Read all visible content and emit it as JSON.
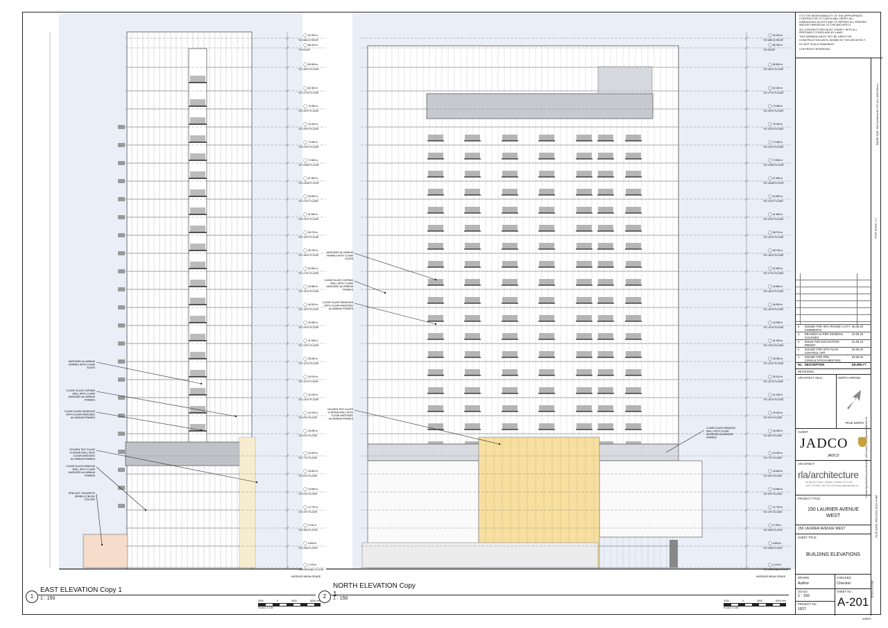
{
  "notes": [
    "IT IS THE RESPONSIBILITY OF THE APPROPRIATE CONTRACTOR TO CHECK AND VERIFY ALL DIMENSIONS ON SITE AND TO REPORT ALL ERRORS AND/OR OMISSIONS TO THE ARCHITECT.",
    "ALL CONTRACTORS MUST COMPLY WITH ALL PERTINENT CODES AND BY-LAWS.",
    "THIS DRAWING MUST NOT BE USED FOR CONSTRUCTION UNTIL SIGNED BY THE ARCHITECT.",
    "DO NOT SCALE DRAWINGS.",
    "COPYRIGHT RESERVED."
  ],
  "revisions": {
    "header": {
      "no": "No.",
      "desc": "DESCRIPTION",
      "date": "DD.MM.YY"
    },
    "rows": [
      {
        "no": "5",
        "desc": "ISSUED FOR SPC ROUND 1 CITY COMMENTS",
        "date": "28.06.23"
      },
      {
        "no": "4",
        "desc": "REVISED AS PER GENERAL CHANGES",
        "date": "10.05.23"
      },
      {
        "no": "3",
        "desc": "ISSUE FOR EXCAVATION PERMIT",
        "date": "31.05.23"
      },
      {
        "no": "2",
        "desc": "ISSUED FOR SITE PLAN CONTROL APP.",
        "date": "30.06.22"
      },
      {
        "no": "1",
        "desc": "ISSUED FOR PRE-CONSULTATION MEETING",
        "date": "03.06.22"
      }
    ],
    "label": "REVISIONS:"
  },
  "architect_seal_label": "ARCHITECT SEAL:",
  "north_arrow_label": "NORTH ARROW:",
  "true_north": "TRUE NORTH",
  "client_label": "CLIENT:",
  "client_logo": "JADCO",
  "client_name": "JADCO",
  "architect_label": "ARCHITECT:",
  "architect_logo": "rla/architecture",
  "architect_address": "56 Beech Street, Ottawa, Ontario K1S 3J6",
  "architect_contact": "t 613 724 9932   f 613 724 1209   www.rlaarchitecture.ca",
  "project_title_label": "PROJECT TITLE:",
  "project_title": "150 LAURIER AVENUE WEST",
  "project_subtitle": "150 LAURIER AVENUE WEST",
  "sheet_title_label": "SHEET TITLE:",
  "sheet_title": "BUILDING ELEVATIONS",
  "drawn_label": "DRAWN:",
  "drawn": "Author",
  "checked_label": "CHECKED:",
  "checked": "Checker",
  "scale_label": "SCALE:",
  "scale": "1 : 150",
  "sheet_no_label": "SHEET No.:",
  "sheet_no": "A-201",
  "project_no_label": "PROJECT No.:",
  "project_no": "1827",
  "bottom_code": "#1863G",
  "paper_size": "PAPER SIZE: ISO Full Bleed B1 (707.00 x 1000.00mm)",
  "plot_scale": "PLOT SCALE: 1:1",
  "file_path": "C:\\Users\\jlambert\\Documents\\1827_150 Laurier_R23_jlambertJADCO.rvt",
  "plot_date": "PLOT DATE: 06/07/2023 10:52:44 AM",
  "view_code": "0C112-22-0128",
  "east": {
    "number": "1",
    "title": "EAST ELEVATION Copy 1",
    "scale": "1 : 150",
    "notes": [
      "ANODIZED ALUMINUM FRAMES WITH CLEAR GLASS",
      "CLEAR GLASS CURTAIN WALL WITH CLEAR ANODIZED ALUMINUM FRAMES",
      "CLEAR GLASS WINDOWS WITH CLEAR ANODIZED ALUMINUM FRAMES",
      "GOLDEN TINT GLASS CURTAIN WALL WITH CLEAR ANODIZED ALUMINUM FRAMES",
      "CLEAR GLASS WINDOW WALL WITH CLEAR ANODIZED ALUMINUM FRAMES",
      "PRECAST CONCRETE EPANELS: BEIGE COLOUR"
    ]
  },
  "north": {
    "number": "2",
    "title": "NORTH ELEVATION Copy 1",
    "scale": "1 : 150",
    "notes": [
      "ANODIZED ALUMINUM FRAMES WITH CLEAR GLASS",
      "CLEAR GLASS CURTAIN WALL WITH CLEAR ANODIZED ALUMINUM FRAMES",
      "CLEAR GLASS WINDOWS WITH CLEAR ANODIZED ALUMINUM FRAMES",
      "GOLDEN TINT GLASS CURTAIN WALL WITH CLEAR ANODIZED ALUMINUM FRAMES",
      "CLEAR GLASS WINDOW WALL WITH CLEAR ANODIZED ALUMINUM FRAMES"
    ]
  },
  "bar_scale": {
    "ticks": [
      "3000",
      "0",
      "3000",
      "6000 mm"
    ],
    "label": "SCALE 1:150"
  },
  "grade_label": "AVERAGE MEAN GRADE",
  "levels": [
    {
      "el": "90.900 m",
      "name": "T/O MECH ROOF"
    },
    {
      "el": "86.400 m",
      "name": "T/O ROOF"
    },
    {
      "el": "85.800 m",
      "name": "T/O 28TH FLOOR"
    },
    {
      "el": "82.300 m",
      "name": "T/O 27TH FLOOR"
    },
    {
      "el": "79.350 m",
      "name": "T/O 26TH FLOOR"
    },
    {
      "el": "76.400 m",
      "name": "T/O 25TH FLOOR"
    },
    {
      "el": "73.450 m",
      "name": "T/O 24TH FLOOR"
    },
    {
      "el": "70.500 m",
      "name": "T/O 23RD FLOOR"
    },
    {
      "el": "67.550 m",
      "name": "T/O 22ND FLOOR"
    },
    {
      "el": "64.600 m",
      "name": "T/O 21ST FLOOR"
    },
    {
      "el": "61.650 m",
      "name": "T/O 20TH FLOOR"
    },
    {
      "el": "58.700 m",
      "name": "T/O 19TH FLOOR"
    },
    {
      "el": "55.750 m",
      "name": "T/O 18TH FLOOR"
    },
    {
      "el": "52.800 m",
      "name": "T/O 17TH FLOOR"
    },
    {
      "el": "49.850 m",
      "name": "T/O 16TH FLOOR"
    },
    {
      "el": "46.900 m",
      "name": "T/O 15TH FLOOR"
    },
    {
      "el": "43.950 m",
      "name": "T/O 14TH FLOOR"
    },
    {
      "el": "41.000 m",
      "name": "T/O 13TH FLOOR"
    },
    {
      "el": "38.050 m",
      "name": "T/O 12TH FLOOR"
    },
    {
      "el": "35.100 m",
      "name": "T/O 11TH FLOOR"
    },
    {
      "el": "32.150 m",
      "name": "T/O 10TH FLOOR"
    },
    {
      "el": "29.200 m",
      "name": "T/O 9TH FLOOR"
    },
    {
      "el": "26.250 m",
      "name": "T/O 8TH FLOOR"
    },
    {
      "el": "23.300 m",
      "name": "T/O 7TH FLOOR"
    },
    {
      "el": "18.600 m",
      "name": "T/O 6TH FLOOR"
    },
    {
      "el": "15.650 m",
      "name": "T/O 5TH FLOOR"
    },
    {
      "el": "12.700 m",
      "name": "T/O 4TH FLOOR"
    },
    {
      "el": "9.750 m",
      "name": "T/O 3RD FLOOR"
    },
    {
      "el": "6.800 m",
      "name": "T/O 2ND FLOOR"
    },
    {
      "el": "2.100 m",
      "name": "T/O GROUND FLOOR"
    }
  ],
  "colors": {
    "sky": "#e7ecf6",
    "gold": "#f6dfa0",
    "beige": "#f6dccb",
    "line": "#222222"
  }
}
